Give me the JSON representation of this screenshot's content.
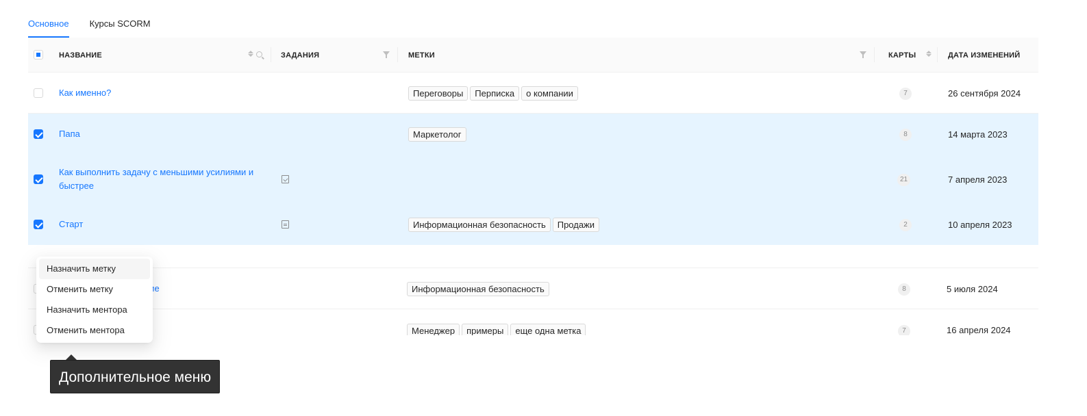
{
  "tabs": [
    {
      "label": "Основное",
      "active": true
    },
    {
      "label": "Курсы SCORM",
      "active": false
    }
  ],
  "columns": {
    "name": "НАЗВАНИЕ",
    "tasks": "ЗАДАНИЯ",
    "tags": "МЕТКИ",
    "cards": "КАРТЫ",
    "date": "ДАТА ИЗМЕНЕНИЙ"
  },
  "rows": [
    {
      "name": "Как именно?",
      "selected": false,
      "task_icon": "",
      "tags": [
        "Переговоры",
        "Перписка",
        "о компании"
      ],
      "cards": "7",
      "date": "26 сентября 2024"
    },
    {
      "name": "Папа",
      "selected": true,
      "task_icon": "",
      "tags": [
        "Маркетолог"
      ],
      "cards": "8",
      "date": "14 марта 2023"
    },
    {
      "name": "Как выполнить задачу с меньшими усилиями и быстрее",
      "selected": true,
      "task_icon": "checkbox-task-icon",
      "tags": [],
      "cards": "21",
      "date": "7 апреля 2023"
    },
    {
      "name": "Старт",
      "selected": true,
      "task_icon": "document-task-icon",
      "tags": [
        "Информационная безопасность",
        "Продажи"
      ],
      "cards": "2",
      "date": "10 апреля 2023"
    },
    {
      "name": "ние",
      "selected": false,
      "task_icon": "",
      "tags": [
        "Информационная безопасность"
      ],
      "cards": "8",
      "date": "5 июля 2024"
    },
    {
      "name": "",
      "selected": false,
      "task_icon": "",
      "tags": [
        "Менеджер",
        "примеры",
        "еще одна метка"
      ],
      "cards": "7",
      "date": "16 апреля 2024"
    }
  ],
  "menu": {
    "items": [
      "Назначить метку",
      "Отменить метку",
      "Назначить ментора",
      "Отменить ментора"
    ]
  },
  "tooltip": {
    "text": "Дополнительное меню"
  },
  "colors": {
    "accent": "#1677ff",
    "selected_row": "#e6f4ff",
    "tooltip_bg": "#333333"
  }
}
